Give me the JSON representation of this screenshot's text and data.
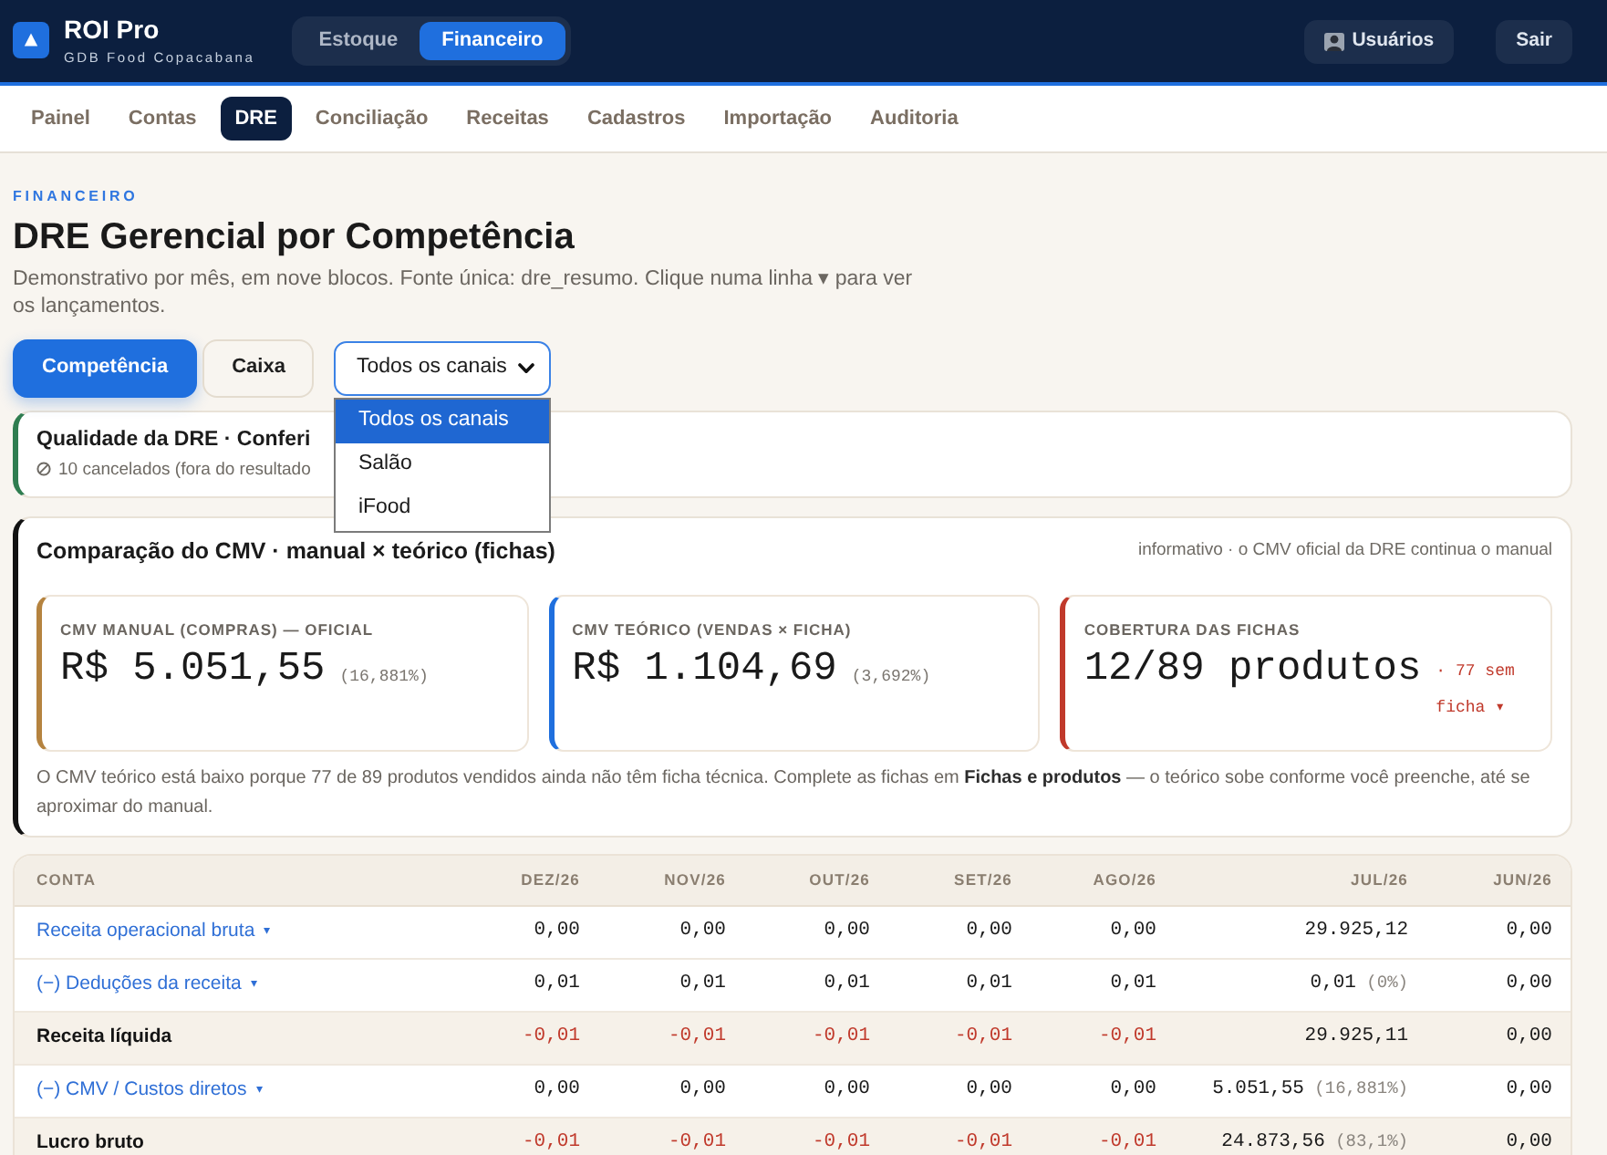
{
  "app": {
    "title": "ROI Pro",
    "subtitle": "GDB Food Copacabana",
    "modules": [
      {
        "label": "Estoque",
        "selected": false
      },
      {
        "label": "Financeiro",
        "selected": true
      }
    ],
    "actions": [
      {
        "kind": "users",
        "label": "Usuários"
      },
      {
        "kind": "logout",
        "label": "Sair"
      }
    ]
  },
  "nav": [
    {
      "label": "Painel",
      "selected": false
    },
    {
      "label": "Contas",
      "selected": false
    },
    {
      "label": "DRE",
      "selected": true
    },
    {
      "label": "Conciliação",
      "selected": false
    },
    {
      "label": "Receitas",
      "selected": false
    },
    {
      "label": "Cadastros",
      "selected": false
    },
    {
      "label": "Importação",
      "selected": false
    },
    {
      "label": "Auditoria",
      "selected": false
    }
  ],
  "page": {
    "eyebrow": "FINANCEIRO",
    "title": "DRE Gerencial por Competência",
    "description": "Demonstrativo por mês, em nove blocos. Fonte única: dre_resumo. Clique numa linha ▾ para ver os lançamentos."
  },
  "basis": [
    {
      "label": "Competência",
      "selected": true
    },
    {
      "label": "Caixa",
      "selected": false
    }
  ],
  "channel_filter": {
    "value": "Todos os canais",
    "expanded": true,
    "options": [
      {
        "label": "Todos os canais",
        "selected": true
      },
      {
        "label": "Salão",
        "selected": false
      },
      {
        "label": "iFood",
        "selected": false
      }
    ]
  },
  "quality": {
    "title": "Qualidade da DRE · Conferi",
    "note": "10 cancelados (fora do resultado"
  },
  "cmv": {
    "title": "Comparação do CMV · manual × teórico (fichas)",
    "aside": "informativo · o CMV oficial da DRE continua o manual",
    "kpis": [
      {
        "label": "CMV MANUAL (COMPRAS) — OFICIAL",
        "value": "R$ 5.051,55",
        "percent": "(16,881%)",
        "color": "#b5833f"
      },
      {
        "label": "CMV TEÓRICO (VENDAS × FICHA)",
        "value": "R$ 1.104,69",
        "percent": "(3,692%)",
        "color": "#1f6fde"
      },
      {
        "label": "COBERTURA DAS FICHAS",
        "value": "12/89 produtos",
        "note": "· 77 sem ficha ▾",
        "color": "#c0392b"
      }
    ],
    "footnote": "O CMV teórico está baixo porque 77 de 89 produtos vendidos ainda não têm ficha técnica. Complete as fichas em **Fichas e produtos** — o teórico sobe conforme você preenche, até se aproximar do manual."
  },
  "table": {
    "columns": [
      "CONTA",
      "DEZ/26",
      "NOV/26",
      "OUT/26",
      "SET/26",
      "AGO/26",
      "JUL/26",
      "JUN/26"
    ],
    "rows": [
      {
        "kind": "account",
        "toggle": "▾",
        "cells": [
          {
            "value": "Receita operacional bruta"
          },
          {
            "value": "0,00",
            "negative": false
          },
          {
            "value": "0,00",
            "negative": false
          },
          {
            "value": "0,00",
            "negative": false
          },
          {
            "value": "0,00",
            "negative": false
          },
          {
            "value": "0,00",
            "negative": false
          },
          {
            "value": "29.925,12",
            "negative": false
          },
          {
            "value": "0,00",
            "negative": false
          }
        ]
      },
      {
        "kind": "account",
        "toggle": "▾",
        "cells": [
          {
            "value": "(−) Deduções da receita"
          },
          {
            "value": "0,01",
            "negative": false
          },
          {
            "value": "0,01",
            "negative": false
          },
          {
            "value": "0,01",
            "negative": false
          },
          {
            "value": "0,01",
            "negative": false
          },
          {
            "value": "0,01",
            "negative": false
          },
          {
            "value": "0,01",
            "percent": "(0%)",
            "negative": false
          },
          {
            "value": "0,00",
            "negative": false
          }
        ]
      },
      {
        "kind": "subtotal",
        "cells": [
          {
            "value": "Receita líquida"
          },
          {
            "value": "-0,01",
            "negative": true
          },
          {
            "value": "-0,01",
            "negative": true
          },
          {
            "value": "-0,01",
            "negative": true
          },
          {
            "value": "-0,01",
            "negative": true
          },
          {
            "value": "-0,01",
            "negative": true
          },
          {
            "value": "29.925,11",
            "negative": false
          },
          {
            "value": "0,00",
            "negative": false
          }
        ]
      },
      {
        "kind": "account",
        "toggle": "▾",
        "cells": [
          {
            "value": "(−) CMV / Custos diretos"
          },
          {
            "value": "0,00",
            "negative": false
          },
          {
            "value": "0,00",
            "negative": false
          },
          {
            "value": "0,00",
            "negative": false
          },
          {
            "value": "0,00",
            "negative": false
          },
          {
            "value": "0,00",
            "negative": false
          },
          {
            "value": "5.051,55",
            "percent": "(16,881%)",
            "negative": false
          },
          {
            "value": "0,00",
            "negative": false
          }
        ]
      },
      {
        "kind": "subtotal",
        "cells": [
          {
            "value": "Lucro bruto"
          },
          {
            "value": "-0,01",
            "negative": true
          },
          {
            "value": "-0,01",
            "negative": true
          },
          {
            "value": "-0,01",
            "negative": true
          },
          {
            "value": "-0,01",
            "negative": true
          },
          {
            "value": "-0,01",
            "negative": true
          },
          {
            "value": "24.873,56",
            "percent": "(83,1%)",
            "negative": false
          },
          {
            "value": "0,00",
            "negative": false
          }
        ]
      }
    ]
  }
}
